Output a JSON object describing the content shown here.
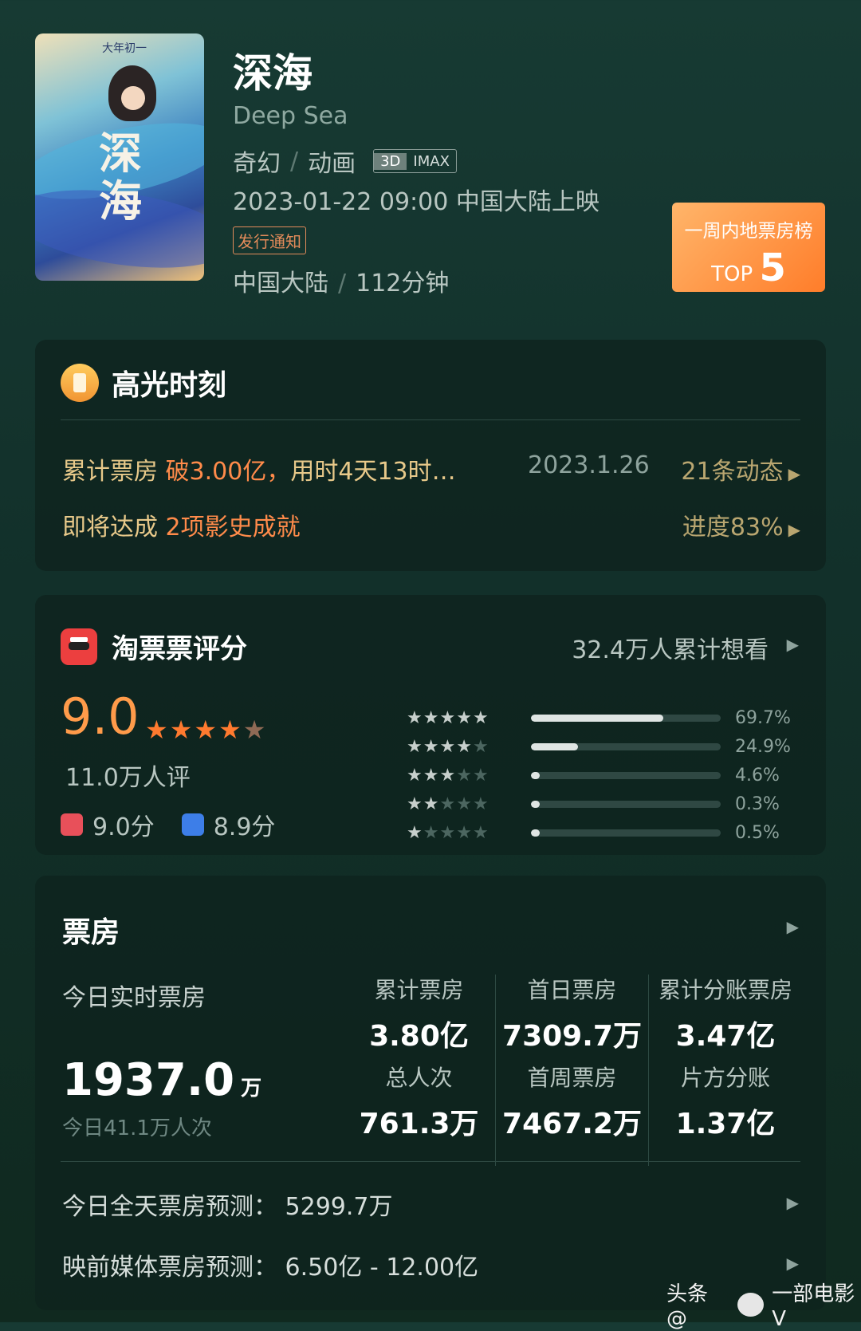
{
  "movie": {
    "title": "深海",
    "en_title": "Deep Sea",
    "genres": [
      "奇幻",
      "动画"
    ],
    "formats": [
      "3D",
      "IMAX"
    ],
    "release": "2023-01-22 09:00 中国大陆上映",
    "notice": "发行通知",
    "region": "中国大陆",
    "duration": "112分钟",
    "poster_text": {
      "top": "大年初一",
      "big": "深海"
    }
  },
  "top_badge": {
    "line1": "一周内地票房榜",
    "prefix": "TOP",
    "rank": "5"
  },
  "highlight": {
    "title": "高光时刻",
    "row1_label": "累计票房",
    "row1_hot": "破3.00亿，",
    "row1_rest": "用时4天13时…",
    "date": "2023.1.26",
    "dynamics": "21条动态",
    "row2_label": "即将达成",
    "row2_hot": "2项影史成就",
    "progress": "进度83%"
  },
  "rating": {
    "title": "淘票票评分",
    "want": "32.4万人累计想看",
    "score": "9.0",
    "stars": 4.5,
    "count": "11.0万人评",
    "female": "9.0分",
    "male": "8.9分",
    "distribution": [
      {
        "stars": 5,
        "pct": "69.7%",
        "value": 69.7
      },
      {
        "stars": 4,
        "pct": "24.9%",
        "value": 24.9
      },
      {
        "stars": 3,
        "pct": "4.6%",
        "value": 4.6
      },
      {
        "stars": 2,
        "pct": "0.3%",
        "value": 0.3
      },
      {
        "stars": 1,
        "pct": "0.5%",
        "value": 0.5
      }
    ]
  },
  "box_office": {
    "title": "票房",
    "today_label": "今日实时票房",
    "today_value": "1937.0",
    "today_unit": "万",
    "today_people": "今日41.1万人次",
    "cells": [
      {
        "label": "累计票房",
        "value": "3.80亿"
      },
      {
        "label": "首日票房",
        "value": "7309.7万"
      },
      {
        "label": "累计分账票房",
        "value": "3.47亿"
      },
      {
        "label": "总人次",
        "value": "761.3万"
      },
      {
        "label": "首周票房",
        "value": "7467.2万"
      },
      {
        "label": "片方分账",
        "value": "1.37亿"
      }
    ],
    "prediction_today": "今日全天票房预测：  5299.7万",
    "prediction_media": "映前媒体票房预测：  6.50亿 - 12.00亿"
  },
  "watermark": {
    "left": "头条 @",
    "right": "一部电影V"
  },
  "colors": {
    "accent": "#ff7d2a",
    "gold": "#e8c98a",
    "hot": "#ff8b4a",
    "bg": "#173a33"
  }
}
